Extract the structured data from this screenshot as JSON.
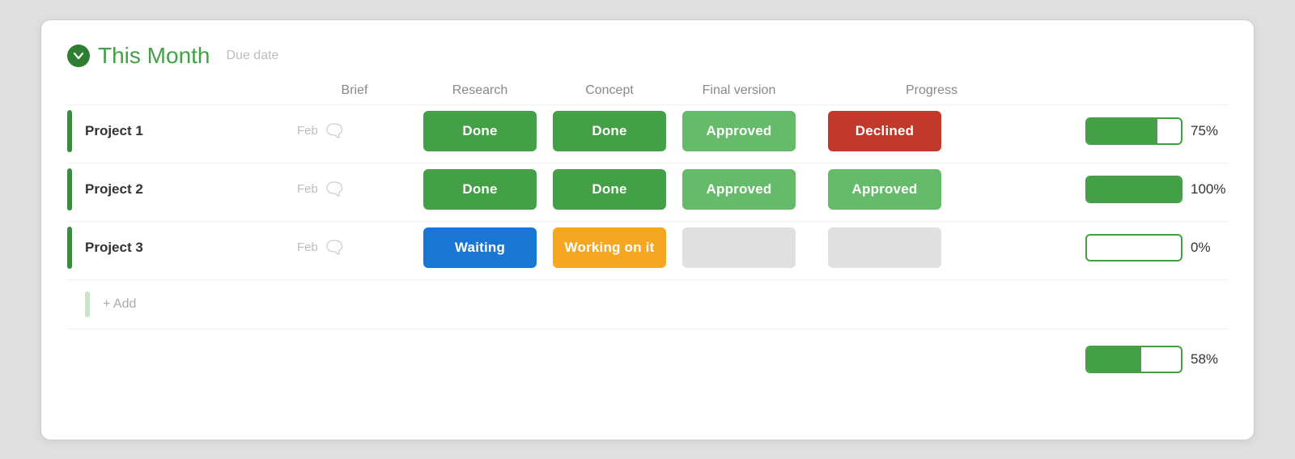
{
  "header": {
    "title": "This Month",
    "due_date_label": "Due date"
  },
  "columns": {
    "brief": "Brief",
    "research": "Research",
    "concept": "Concept",
    "final_version": "Final version",
    "progress": "Progress"
  },
  "projects": [
    {
      "name": "Project 1",
      "due": "Feb",
      "brief": "Done",
      "brief_style": "green",
      "research": "Done",
      "research_style": "green",
      "concept": "Approved",
      "concept_style": "approved",
      "final_version": "Declined",
      "final_version_style": "declined",
      "progress_pct": 75,
      "progress_label": "75%"
    },
    {
      "name": "Project 2",
      "due": "Feb",
      "brief": "Done",
      "brief_style": "green",
      "research": "Done",
      "research_style": "green",
      "concept": "Approved",
      "concept_style": "approved",
      "final_version": "Approved",
      "final_version_style": "approved",
      "progress_pct": 100,
      "progress_label": "100%"
    },
    {
      "name": "Project 3",
      "due": "Feb",
      "brief": "Waiting",
      "brief_style": "waiting",
      "research": "Working on it",
      "research_style": "working",
      "concept": "",
      "concept_style": "empty",
      "final_version": "",
      "final_version_style": "empty",
      "progress_pct": 0,
      "progress_label": "0%"
    }
  ],
  "add_label": "+ Add",
  "footer_progress_pct": 58,
  "footer_progress_label": "58%",
  "colors": {
    "green": "#43a047",
    "approved": "#66bb6a",
    "declined": "#c0392b",
    "waiting": "#1976d2",
    "working": "#f5a623",
    "empty": "#e0e0e0"
  }
}
